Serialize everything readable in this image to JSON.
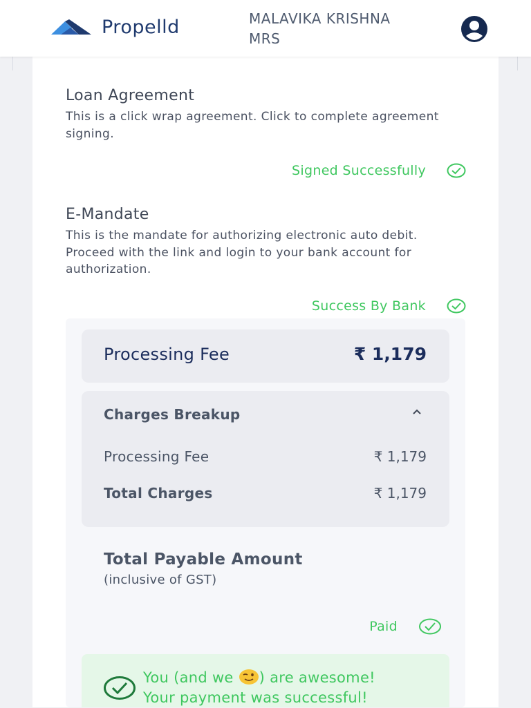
{
  "header": {
    "brand": "Propelld",
    "user_line1": "MALAVIKA KRISHNA",
    "user_line2": "MRS",
    "logo_icon": "propelld-logo",
    "account_icon": "user-circle-icon"
  },
  "loan_agreement": {
    "title": "Loan Agreement",
    "description": "This is a click wrap agreement. Click to complete agreement signing.",
    "status": "Signed Successfully"
  },
  "e_mandate": {
    "title": "E-Mandate",
    "description": "This is the mandate for authorizing electronic auto debit. Proceed with the link and login to your bank account for authorization.",
    "status": "Success By Bank"
  },
  "fee": {
    "label": "Processing Fee",
    "amount": "₹ 1,179"
  },
  "breakup": {
    "title": "Charges Breakup",
    "rows": [
      {
        "label": "Processing Fee",
        "amount": "₹ 1,179"
      },
      {
        "label": "Total Charges",
        "amount": "₹ 1,179"
      }
    ]
  },
  "payable": {
    "title": "Total Payable Amount",
    "subtitle": "(inclusive of GST)",
    "status": "Paid"
  },
  "success": {
    "line1_a": "You (and we ",
    "line1_b": ") are awesome!",
    "line2": "Your payment was successful!"
  },
  "colors": {
    "success_green": "#3fc75f",
    "brand_navy": "#1f3a6e",
    "panel_grey": "#ebecf1"
  }
}
